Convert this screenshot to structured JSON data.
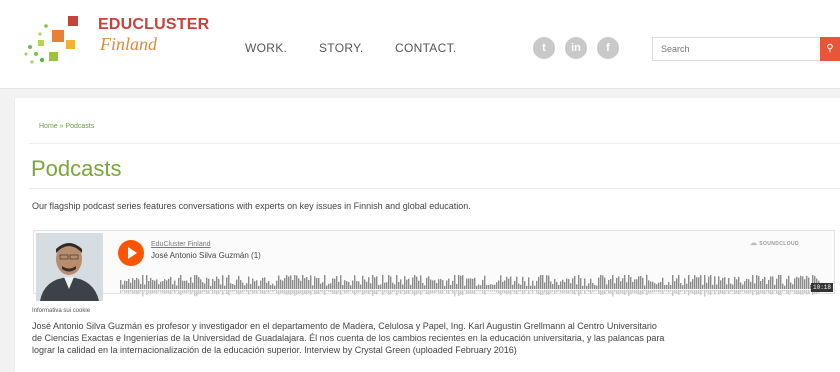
{
  "header": {
    "brand_title": "EDUCLUSTER",
    "brand_sub": "Finland",
    "nav": [
      "WORK.",
      "STORY.",
      "CONTACT."
    ],
    "social": [
      {
        "name": "twitter-icon",
        "glyph": "t"
      },
      {
        "name": "linkedin-icon",
        "glyph": "in"
      },
      {
        "name": "facebook-icon",
        "glyph": "f"
      }
    ],
    "search_placeholder": "Search",
    "search_icon": "search-icon"
  },
  "breadcrumb": "Home » Podcasts",
  "page_title": "Podcasts",
  "intro": "Our flagship podcast series features conversations with experts on key issues in Finnish and global education.",
  "player": {
    "author": "EduCluster Finland",
    "track": "José Antonio Silva Guzmán (1)",
    "brand": "SOUNDCLOUD",
    "duration": "10:18",
    "cookie_label": "Informativa sui cookie"
  },
  "description": [
    "José Antonio Silva Guzmán es profesor y investigador en el departamento de Madera, Celulosa y Papel, Ing. Karl Augustin Grellmann al Centro Universitario",
    "de Ciencias Exactas e Ingenierías de la Universidad de Guadalajara. Él nos cuenta de los cambios recientes en la educación universitaria, y las palancas para",
    "lograr la calidad en la internacionalización de la educación superior. Interview by Crystal Green (uploaded February 2016)"
  ],
  "colors": {
    "brand_red": "#c8413a",
    "accent_green": "#7aa63a",
    "soundcloud_orange": "#ff5500",
    "search_button": "#e8553b"
  }
}
